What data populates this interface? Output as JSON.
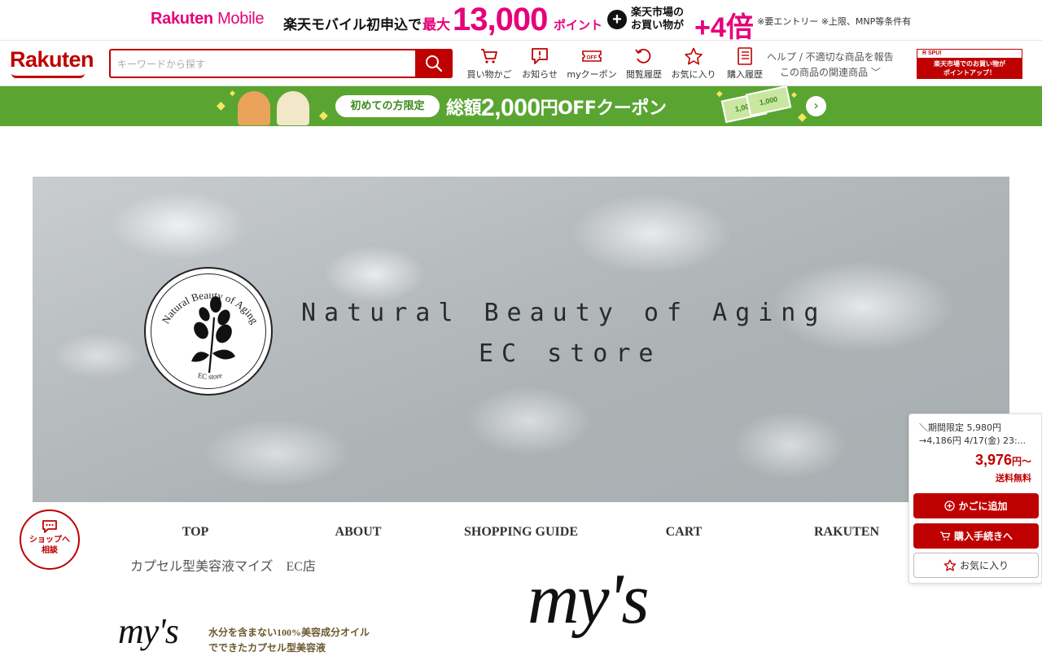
{
  "promo": {
    "brand_a": "Rakuten",
    "brand_b": " Mobile",
    "headline": "楽天モバイル初申込で",
    "max_label": "最大",
    "points": "13,000",
    "points_unit": "ポイント",
    "plus": "+",
    "ichiba_line1": "楽天市場の",
    "ichiba_line2": "お買い物が",
    "multiplier": "+4倍",
    "note": "※要エントリー ※上限、MNP等条件有"
  },
  "header": {
    "logo": "Rakuten",
    "search_placeholder": "キーワードから探す",
    "nav": [
      {
        "label": "買い物かご",
        "icon": "cart-icon"
      },
      {
        "label": "お知らせ",
        "icon": "notice-icon"
      },
      {
        "label": "myクーポン",
        "icon": "coupon-icon"
      },
      {
        "label": "閲覧履歴",
        "icon": "history-icon"
      },
      {
        "label": "お気に入り",
        "icon": "star-icon"
      },
      {
        "label": "購入履歴",
        "icon": "list-icon"
      }
    ],
    "help_line1": "ヘルプ / 不適切な商品を報告",
    "help_line2": "この商品の関連商品",
    "spu_top": "R SPU!",
    "spu_line1": "楽天市場でのお買い物が",
    "spu_line2": "ポイントアップ！"
  },
  "coupon": {
    "pill": "初めての方限定",
    "prefix": "総額",
    "amount": "2,000",
    "suffix": "円OFFクーポン",
    "bill1": "1,000",
    "bill2": "1,000",
    "arrow": "›"
  },
  "banner": {
    "title_line1": "Natural Beauty of Aging",
    "title_line2": "EC store",
    "seal_text_top": "Natural Beauty of Aging",
    "seal_text_bottom": "EC store"
  },
  "shop_nav": [
    "TOP",
    "ABOUT",
    "SHOPPING GUIDE",
    "CART",
    "RAKUTEN"
  ],
  "breadcrumb": "カプセル型美容液マイズ　EC店",
  "brand_logo": "my's",
  "tagline_line1": "水分を含まない100%美容成分オイル",
  "tagline_line2": "でできたカプセル型美容液",
  "consult": {
    "line1": "ショップへ",
    "line2": "相談"
  },
  "buy_panel": {
    "line1": "＼期間限定 5,980円",
    "line2": "→4,186円 4/17(金) 23:...",
    "price": "3,976",
    "price_unit": "円〜",
    "shipping": "送料無料",
    "add_to_cart": "かごに追加",
    "checkout": "購入手続きへ",
    "favorite": "お気に入り"
  },
  "colors": {
    "rakuten_red": "#bf0000",
    "mobile_pink": "#e6007a",
    "coupon_green": "#5aa532"
  }
}
